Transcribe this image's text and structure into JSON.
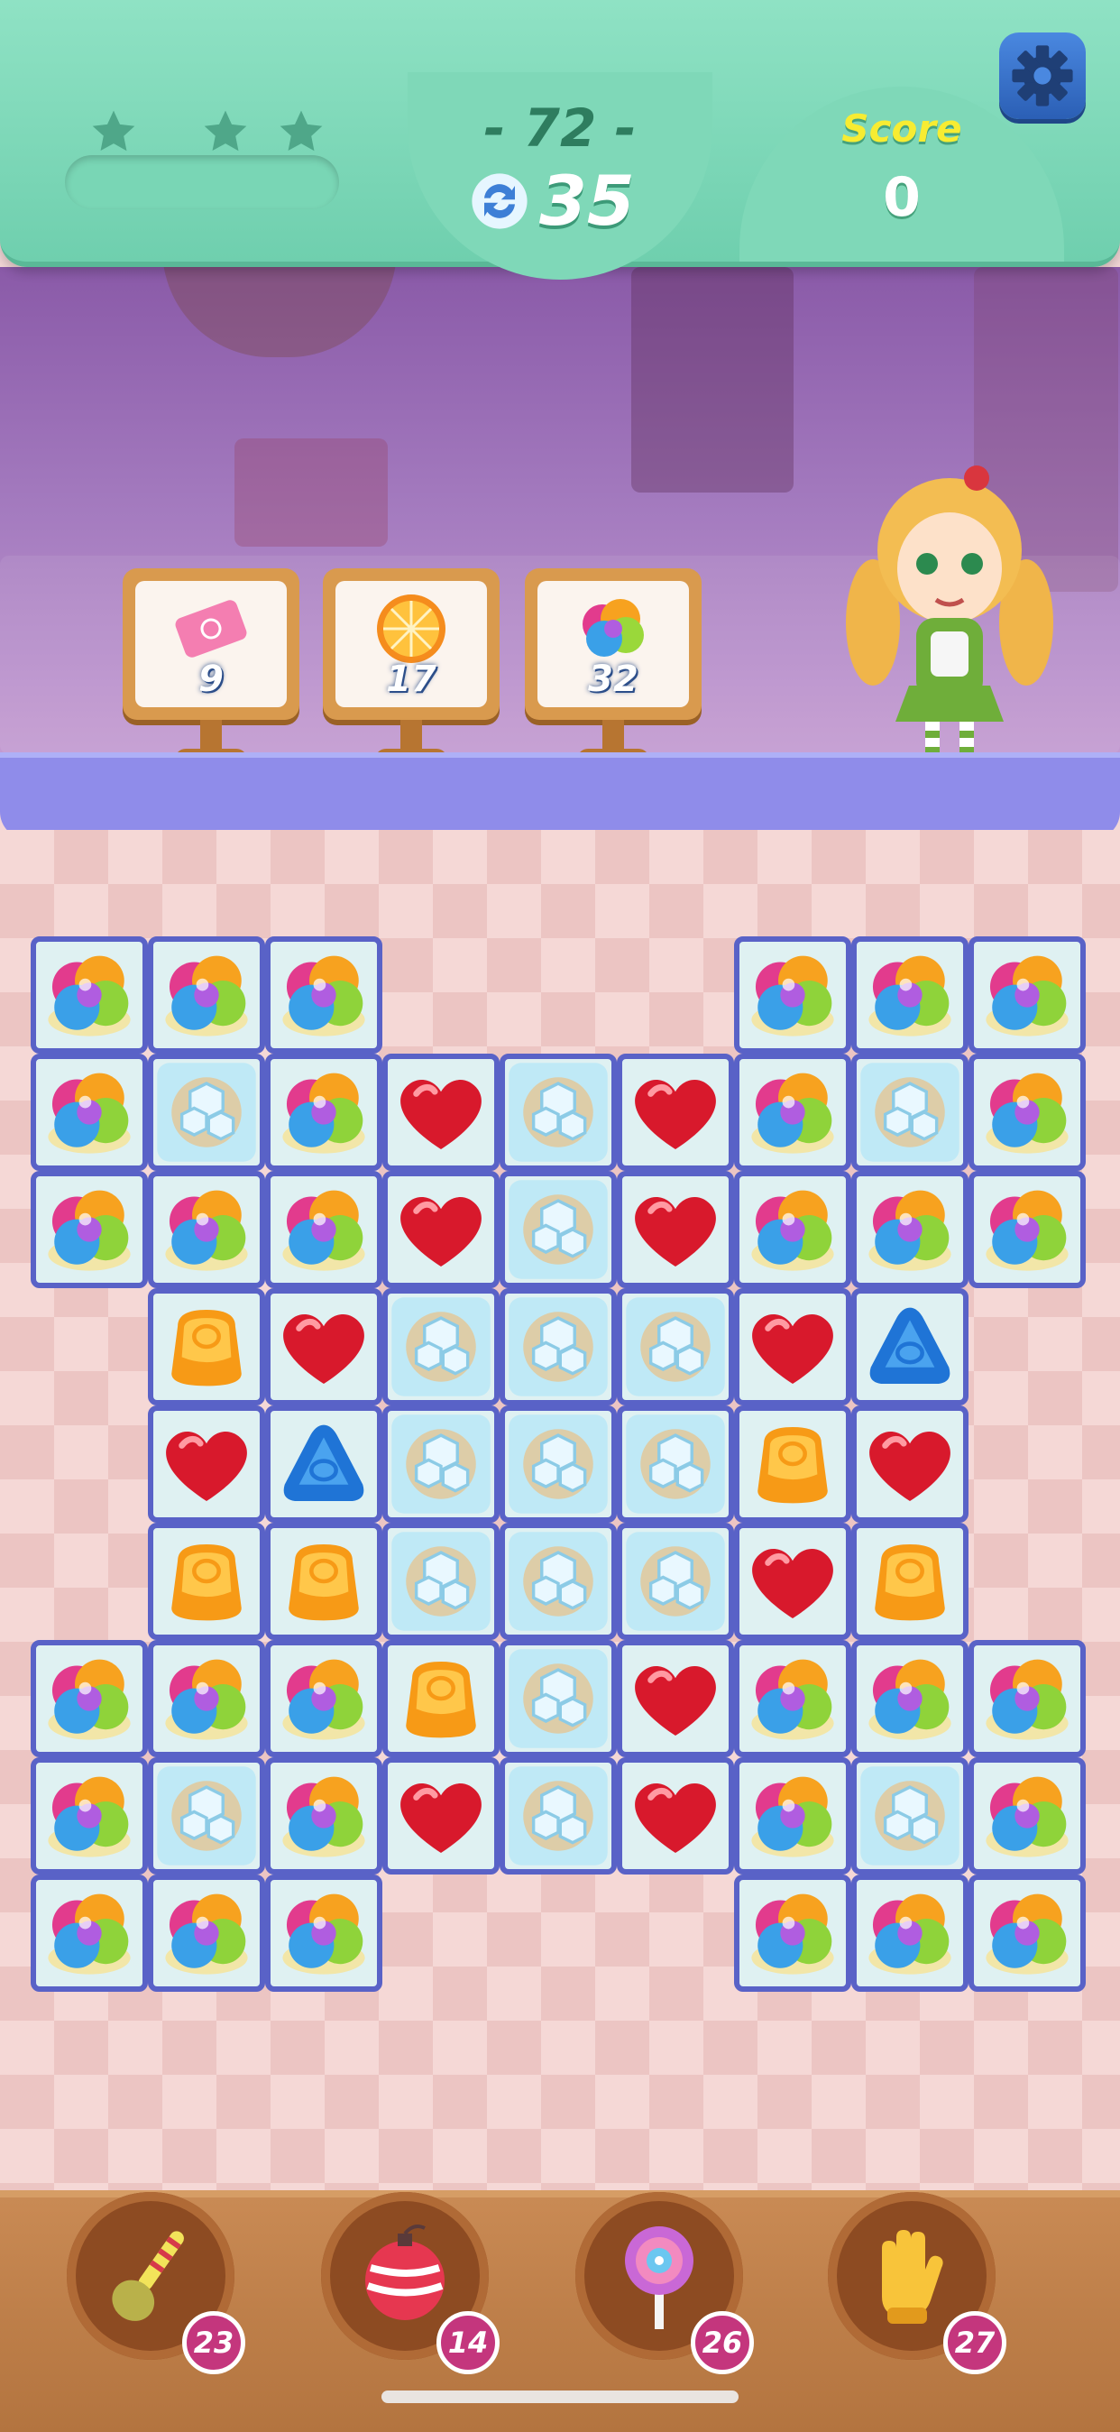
{
  "hud": {
    "level": "- 72 -",
    "moves": "35",
    "score_label": "Score",
    "score": "0",
    "stars": 3,
    "progress": 0
  },
  "goals": [
    {
      "icon": "ticket-icon",
      "count": "9"
    },
    {
      "icon": "orange-slice-icon",
      "count": "17"
    },
    {
      "icon": "rainbow-swirl-icon",
      "count": "32"
    }
  ],
  "board": {
    "cols": 9,
    "rows": 9,
    "legend": {
      "R": "rainbow-swirl-icon",
      "I": "ice-block-icon",
      "H": "red-heart-candy-icon",
      "O": "orange-jelly-candy-icon",
      "B": "blue-triangle-candy-icon"
    },
    "grid": [
      [
        "R",
        "R",
        "R",
        "",
        "",
        "",
        "R",
        "R",
        "R"
      ],
      [
        "R",
        "I",
        "R",
        "H",
        "I",
        "H",
        "R",
        "I",
        "R"
      ],
      [
        "R",
        "R",
        "R",
        "H",
        "I",
        "H",
        "R",
        "R",
        "R"
      ],
      [
        "",
        "O",
        "H",
        "I",
        "I",
        "I",
        "H",
        "B",
        ""
      ],
      [
        "",
        "H",
        "B",
        "I",
        "I",
        "I",
        "O",
        "H",
        ""
      ],
      [
        "",
        "O",
        "O",
        "I",
        "I",
        "I",
        "H",
        "O",
        ""
      ],
      [
        "R",
        "R",
        "R",
        "O",
        "I",
        "H",
        "R",
        "R",
        "R"
      ],
      [
        "R",
        "I",
        "R",
        "H",
        "I",
        "H",
        "R",
        "I",
        "R"
      ],
      [
        "R",
        "R",
        "R",
        "",
        "",
        "",
        "R",
        "R",
        "R"
      ]
    ]
  },
  "boosters": [
    {
      "name": "spoon-booster",
      "icon": "spoon-icon",
      "count": "23"
    },
    {
      "name": "bomb-booster",
      "icon": "bomb-icon",
      "count": "14"
    },
    {
      "name": "lollipop-booster",
      "icon": "lollipop-icon",
      "count": "26"
    },
    {
      "name": "glove-booster",
      "icon": "glove-icon",
      "count": "27"
    }
  ],
  "colors": {
    "hud": "#7fd8b8",
    "board_border": "#5962c7",
    "badge": "#c4367d"
  }
}
